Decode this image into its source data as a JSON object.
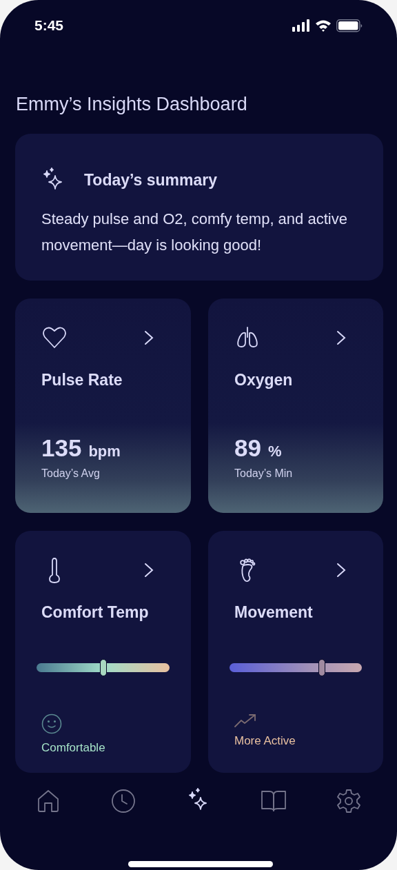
{
  "status_bar": {
    "time": "5:45"
  },
  "title": "Emmy’s Insights Dashboard",
  "summary": {
    "title": "Today’s summary",
    "text": "Steady pulse and O2, comfy temp, and active movement—day is looking good!"
  },
  "metrics": [
    {
      "kind": "reading",
      "title": "Pulse Rate",
      "value": "135",
      "unit": "bpm",
      "caption": "Today’s Avg"
    },
    {
      "kind": "reading",
      "title": "Oxygen",
      "value": "89",
      "unit": "%",
      "caption": "Today’s Min"
    },
    {
      "kind": "slider",
      "title": "Comfort Temp",
      "level": 0.5,
      "status": "Comfortable",
      "color": "#a6e3c8"
    },
    {
      "kind": "slider",
      "title": "Movement",
      "level": 0.7,
      "status": "More Active",
      "color": "#e8c0a0"
    }
  ],
  "nav": [
    {
      "selected": false
    },
    {
      "selected": false
    },
    {
      "selected": true
    },
    {
      "selected": false
    },
    {
      "selected": false
    }
  ]
}
